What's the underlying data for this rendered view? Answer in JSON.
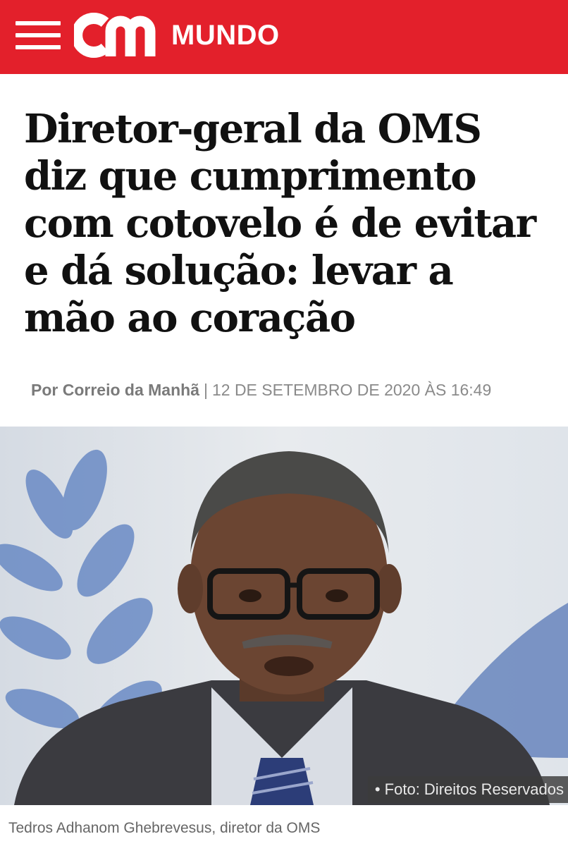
{
  "header": {
    "section": "MUNDO",
    "logo_text": "cm",
    "colors": {
      "brand_red": "#e3202b"
    },
    "icons": [
      "hamburger-menu-icon"
    ]
  },
  "article": {
    "headline": "Diretor-geral da OMS diz que cumprimento com cotovelo é de evitar e dá solução: levar a mão ao coração",
    "author": "Por Correio da Manhã",
    "separator": "|",
    "date": "12 DE SETEMBRO DE 2020 ÀS 16:49",
    "image_credit": "• Foto: Direitos Reservados",
    "caption": "Tedros Adhanom Ghebrevesus, diretor da OMS"
  }
}
